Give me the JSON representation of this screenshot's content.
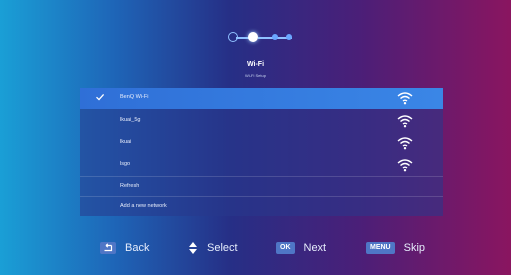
{
  "stepper": {
    "total_steps": 3,
    "current_step": 2
  },
  "header": {
    "title": "Wi-Fi",
    "subtitle": "Wi-Fi Setup"
  },
  "networks": [
    {
      "name": "BenQ Wi-Fi",
      "selected": true
    },
    {
      "name": "lkuai_5g",
      "selected": false
    },
    {
      "name": "lkuai",
      "selected": false
    },
    {
      "name": "lsgo",
      "selected": false
    }
  ],
  "actions": [
    {
      "label": "Refresh"
    },
    {
      "label": "Add a new network"
    }
  ],
  "hints": {
    "back": {
      "label": "Back",
      "icon": "back-arrow-icon"
    },
    "select": {
      "label": "Select",
      "icon": "up-down-arrows-icon"
    },
    "next": {
      "key": "OK",
      "label": "Next"
    },
    "skip": {
      "key": "MENU",
      "label": "Skip"
    }
  },
  "colors": {
    "accent": "#3a86e6",
    "key_bg": "#4f76c6"
  }
}
